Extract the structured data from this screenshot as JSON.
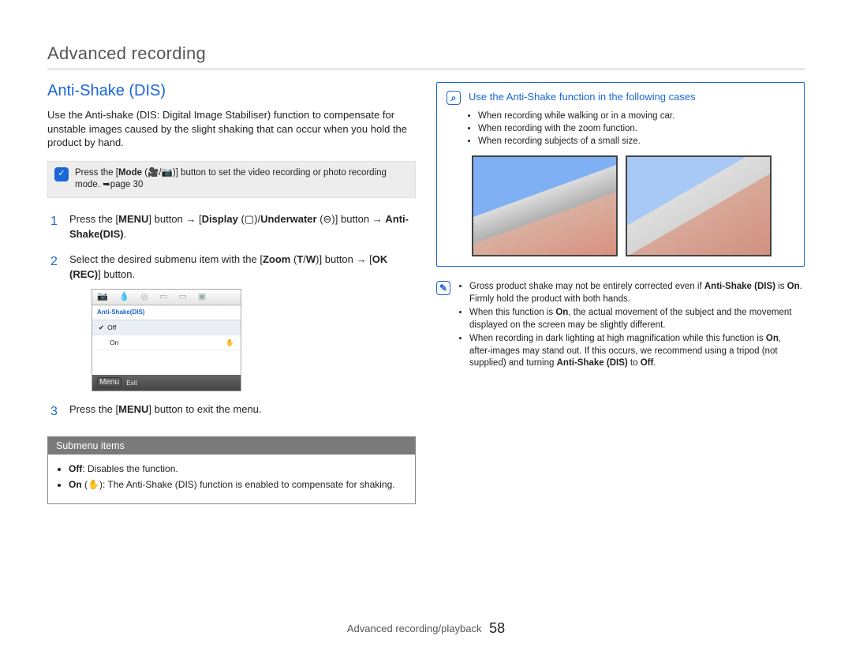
{
  "chapter": "Advanced recording",
  "section": "Anti-Shake (DIS)",
  "intro": "Use the Anti-shake (DIS: Digital Image Stabiliser) function to compensate for unstable images caused by the slight shaking that can occur when you hold the product by hand.",
  "mode_note": {
    "prefix": "Press the [",
    "mode": "Mode",
    "middle": " (🎥/📷)] button to set the video recording or photo recording mode. ",
    "pageref": "➥page 30"
  },
  "steps": [
    {
      "parts": [
        "Press the [",
        "MENU",
        "] button ",
        "→",
        " [",
        "Display",
        " (▢)/",
        "Underwater",
        " (⊖)] button ",
        "→",
        " ",
        "Anti-Shake(DIS)",
        "."
      ]
    },
    {
      "parts": [
        "Select the desired submenu item with the [",
        "Zoom",
        " (",
        "T",
        "/",
        "W",
        ")] button ",
        "→",
        " [",
        "OK (REC)",
        "] button."
      ]
    },
    {
      "parts": [
        "Press the [",
        "MENU",
        "] button to exit the menu."
      ]
    }
  ],
  "screenshot": {
    "title": "Anti-Shake(DIS)",
    "rows": [
      "Off",
      "On"
    ],
    "exit": "Exit",
    "menu_label": "Menu"
  },
  "submenu": {
    "title": "Submenu items",
    "items": [
      {
        "label": "Off",
        "desc": ": Disables the function."
      },
      {
        "label": "On",
        "icon": "(✋)",
        "desc": ": The Anti-Shake (DIS) function is enabled to compensate for shaking."
      }
    ]
  },
  "usecases": {
    "title": "Use the Anti-Shake function in the following cases",
    "items": [
      "When recording while walking or in a moving car.",
      "When recording with the zoom function.",
      "When recording subjects of a small size."
    ]
  },
  "notes": [
    "Gross product shake may not be entirely corrected even if <b>Anti-Shake (DIS)</b> is <b>On</b>. Firmly hold the product with both hands.",
    "When this function is <b>On</b>, the actual movement of the subject and the movement displayed on the screen may be slightly different.",
    "When recording in dark lighting at high magnification while this function is <b>On</b>, after-images may stand out. If this occurs, we recommend using a tripod (not supplied) and turning <b>Anti-Shake (DIS)</b> to <b>Off</b>."
  ],
  "footer": {
    "chapter": "Advanced recording/playback",
    "page": "58"
  }
}
